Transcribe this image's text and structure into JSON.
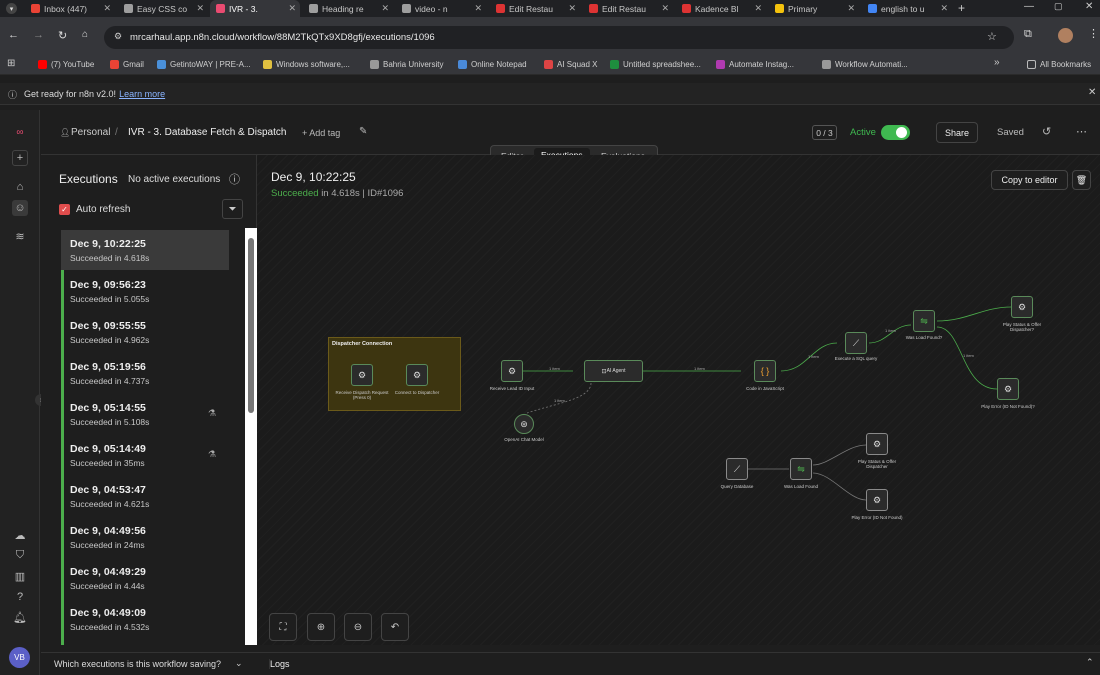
{
  "browser": {
    "tabs": [
      {
        "label": "Inbox (447)",
        "color": "#ea4335"
      },
      {
        "label": "Easy CSS co",
        "color": "#9e9e9e"
      },
      {
        "label": "IVR - 3.",
        "color": "#ea4b71"
      },
      {
        "label": "Heading re",
        "color": "#9e9e9e"
      },
      {
        "label": "video - n",
        "color": "#9e9e9e"
      },
      {
        "label": "Edit Restau",
        "color": "#d33"
      },
      {
        "label": "Edit Restau",
        "color": "#d33"
      },
      {
        "label": "Kadence Bl",
        "color": "#d33"
      },
      {
        "label": "Primary",
        "color": "#f4c20d"
      },
      {
        "label": "english to u",
        "color": "#4285f4"
      }
    ],
    "url": "mrcarhaul.app.n8n.cloud/workflow/88M2TkQTx9XD8gfj/executions/1096",
    "bookmarks": [
      "(7) YouTube",
      "Gmail",
      "GetintoWAY | PRE-A...",
      "Windows software,...",
      "Bahria University",
      "Online Notepad",
      "AI Squad X",
      "Untitled spreadshee...",
      "Automate Instag...",
      "Workflow Automati..."
    ],
    "all_bookmarks": "All Bookmarks"
  },
  "banner": {
    "text": "Get ready for n8n v2.0!",
    "link": "Learn more"
  },
  "header": {
    "owner": "Personal",
    "separator": "/",
    "workflow_name": "IVR - 3. Database Fetch & Dispatch",
    "add_tag": "+ Add tag",
    "counter": "0 / 3",
    "active_label": "Active",
    "share": "Share",
    "saved": "Saved"
  },
  "tabs": {
    "editor": "Editor",
    "executions": "Executions",
    "evaluations": "Evaluations"
  },
  "executions": {
    "title": "Executions",
    "no_active": "No active executions",
    "auto_refresh": "Auto refresh",
    "items": [
      {
        "date": "Dec 9, 10:22:25",
        "status": "Succeeded in 4.618s"
      },
      {
        "date": "Dec 9, 09:56:23",
        "status": "Succeeded in 5.055s"
      },
      {
        "date": "Dec 9, 09:55:55",
        "status": "Succeeded in 4.962s"
      },
      {
        "date": "Dec 9, 05:19:56",
        "status": "Succeeded in 4.737s"
      },
      {
        "date": "Dec 9, 05:14:55",
        "status": "Succeeded in 5.108s"
      },
      {
        "date": "Dec 9, 05:14:49",
        "status": "Succeeded in 35ms"
      },
      {
        "date": "Dec 9, 04:53:47",
        "status": "Succeeded in 4.621s"
      },
      {
        "date": "Dec 9, 04:49:56",
        "status": "Succeeded in 24ms"
      },
      {
        "date": "Dec 9, 04:49:29",
        "status": "Succeeded in 4.44s"
      },
      {
        "date": "Dec 9, 04:49:09",
        "status": "Succeeded in 4.532s"
      }
    ],
    "saving_question": "Which executions is this workflow saving?"
  },
  "detail": {
    "date": "Dec 9, 10:22:25",
    "succeeded": "Succeeded",
    "in_time": "in 4.618s",
    "id": "| ID#1096",
    "copy_to_editor": "Copy to editor"
  },
  "canvas": {
    "sticky_title": "Dispatcher Connection",
    "nodes": {
      "receive_dispatch": "Receive Dispatch Request (Press 0)",
      "connect_dispatcher": "Connect to Dispatcher",
      "receive_lead": "Receive Lead ID Input",
      "ai_agent": "AI Agent",
      "openai_model": "OpenAI Chat Model",
      "code_js": "Code in JavaScript",
      "execute_sql": "Execute a SQL query",
      "was_load_found_1": "Was Load Found?",
      "play_status_1": "Play Status & Offer Dispatcher?",
      "play_error_1": "Play Error (ID Not Found)?",
      "query_database": "Query Database",
      "was_load_found_2": "Was Load Found",
      "play_status_2": "Play Status & Offer Dispatcher",
      "play_error_2": "Play Error (ID Not Found)"
    },
    "edge_item": "1 item"
  },
  "logs": "Logs",
  "colors": {
    "accent": "#ea4b71",
    "success": "#4cae4c",
    "toggle": "#3fb950",
    "sticky": "#3d3510"
  }
}
